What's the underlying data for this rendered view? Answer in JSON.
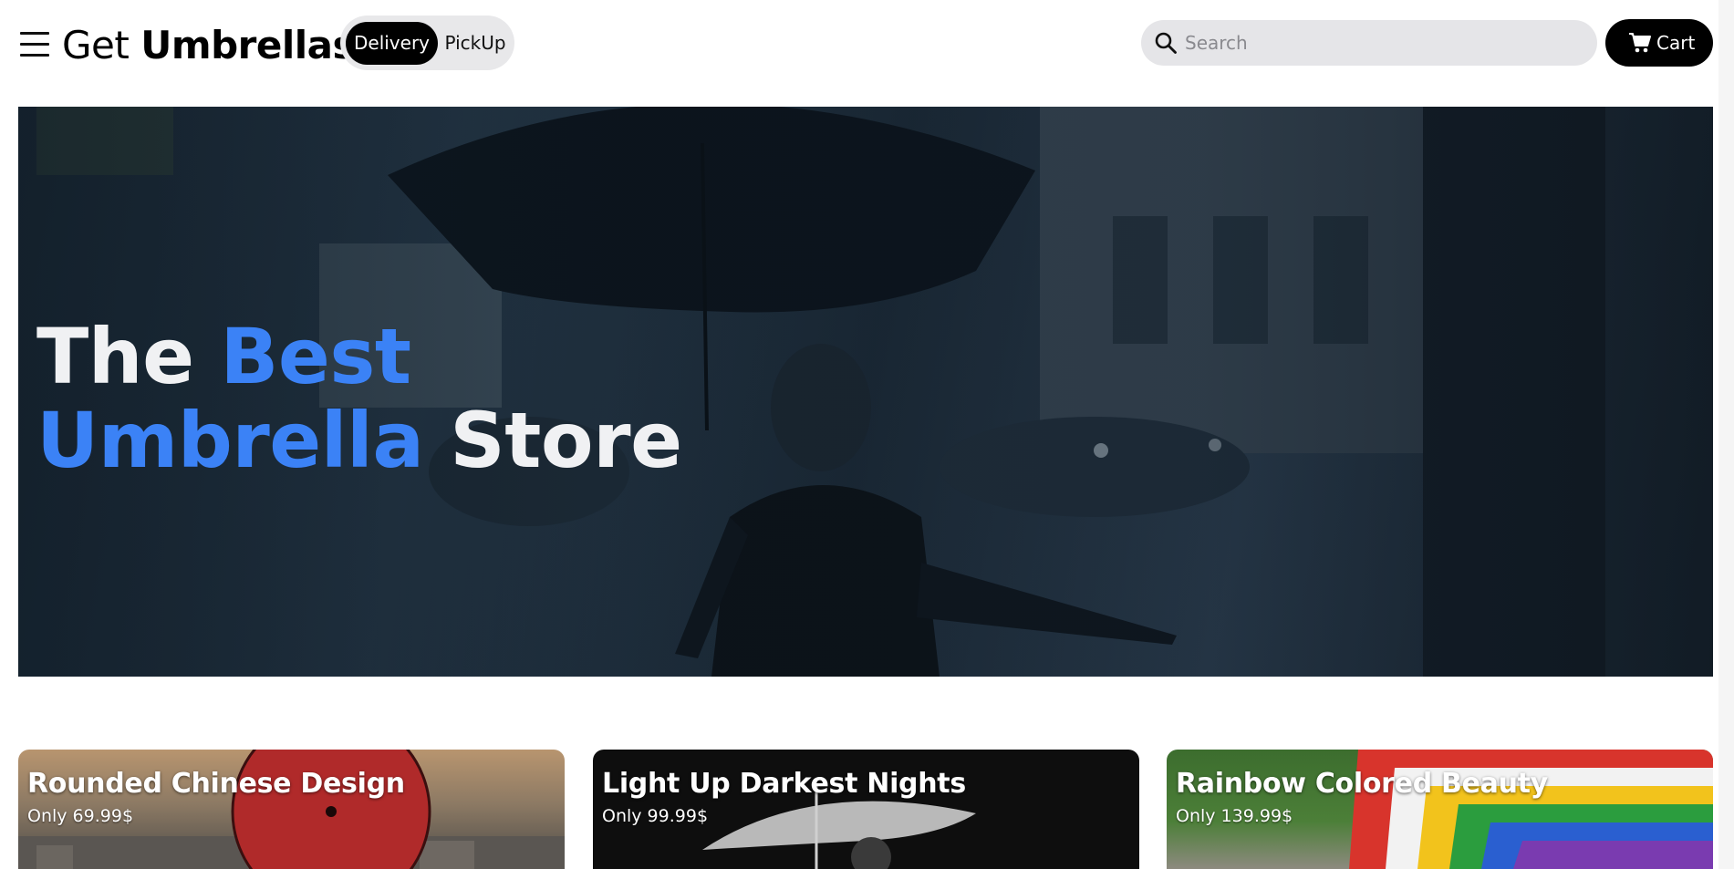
{
  "header": {
    "logo_light": "Get",
    "logo_bold": "Umbrellas",
    "menu_icon": "hamburger-menu-icon",
    "modes": [
      {
        "label": "Delivery",
        "selected": true
      },
      {
        "label": "PickUp",
        "selected": false
      }
    ],
    "search": {
      "placeholder": "Search",
      "value": "",
      "icon": "search-icon"
    },
    "cart": {
      "label": "Cart",
      "icon": "shopping-cart-icon"
    }
  },
  "hero": {
    "line1_plain": "The",
    "line1_accent": "Best",
    "line2_accent": "Umbrella",
    "line2_plain": "Store",
    "accent_color": "#3b82f6"
  },
  "products": [
    {
      "title": "Rounded Chinese Design",
      "price": "Only 69.99$"
    },
    {
      "title": "Light Up Darkest Nights",
      "price": "Only 99.99$"
    },
    {
      "title": "Rainbow Colored Beauty",
      "price": "Only 139.99$"
    }
  ]
}
